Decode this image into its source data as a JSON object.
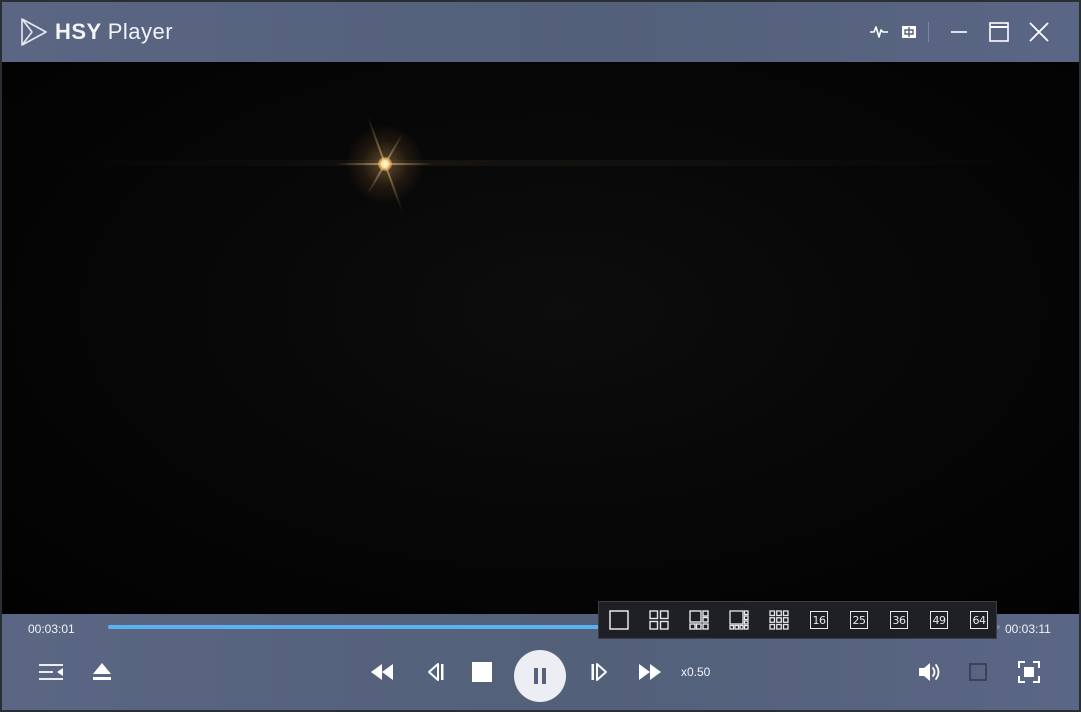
{
  "app": {
    "brand": "HSY",
    "name": "Player"
  },
  "titlebar": {
    "icons": [
      "waveform-icon",
      "subtitle-icon",
      "minimize-icon",
      "maximize-icon",
      "close-icon"
    ]
  },
  "playback": {
    "current_time": "00:03:01",
    "total_time": "00:03:11",
    "progress_percent": 55,
    "speed": "x0.50"
  },
  "layout_menu": {
    "options": [
      "1",
      "4",
      "6",
      "8",
      "9",
      "16",
      "25",
      "36",
      "49",
      "64"
    ]
  },
  "colors": {
    "chrome": "#56627d",
    "progress": "#5bb1f2",
    "icon": "#ffffff"
  }
}
